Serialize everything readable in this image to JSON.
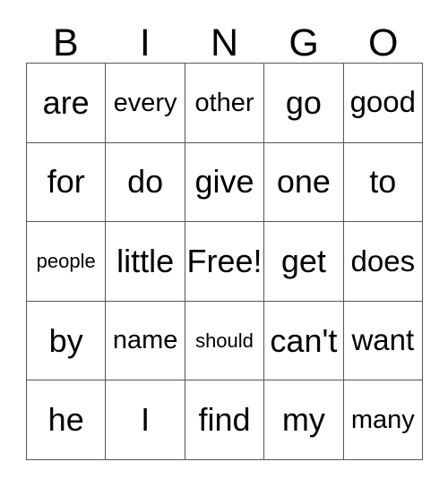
{
  "card": {
    "title_letters": [
      "B",
      "I",
      "N",
      "G",
      "O"
    ],
    "free_space_label": "Free!",
    "colors": {
      "background": "#ffffff",
      "grid_line": "#555555",
      "text": "#000000"
    },
    "grid": {
      "columns": 5,
      "rows": 5,
      "cells": [
        [
          {
            "text": "are",
            "size": "xl"
          },
          {
            "text": "every",
            "size": "m"
          },
          {
            "text": "other",
            "size": "m"
          },
          {
            "text": "go",
            "size": "xl"
          },
          {
            "text": "good",
            "size": "l"
          }
        ],
        [
          {
            "text": "for",
            "size": "xl"
          },
          {
            "text": "do",
            "size": "xl"
          },
          {
            "text": "give",
            "size": "xl"
          },
          {
            "text": "one",
            "size": "xl"
          },
          {
            "text": "to",
            "size": "xl"
          }
        ],
        [
          {
            "text": "people",
            "size": "s"
          },
          {
            "text": "little",
            "size": "xl"
          },
          {
            "text": "Free!",
            "size": "xl"
          },
          {
            "text": "get",
            "size": "xl"
          },
          {
            "text": "does",
            "size": "l"
          }
        ],
        [
          {
            "text": "by",
            "size": "xl"
          },
          {
            "text": "name",
            "size": "m"
          },
          {
            "text": "should",
            "size": "s"
          },
          {
            "text": "can't",
            "size": "xl"
          },
          {
            "text": "want",
            "size": "l"
          }
        ],
        [
          {
            "text": "he",
            "size": "xl"
          },
          {
            "text": "I",
            "size": "xl"
          },
          {
            "text": "find",
            "size": "xl"
          },
          {
            "text": "my",
            "size": "xl"
          },
          {
            "text": "many",
            "size": "m"
          }
        ]
      ]
    }
  }
}
